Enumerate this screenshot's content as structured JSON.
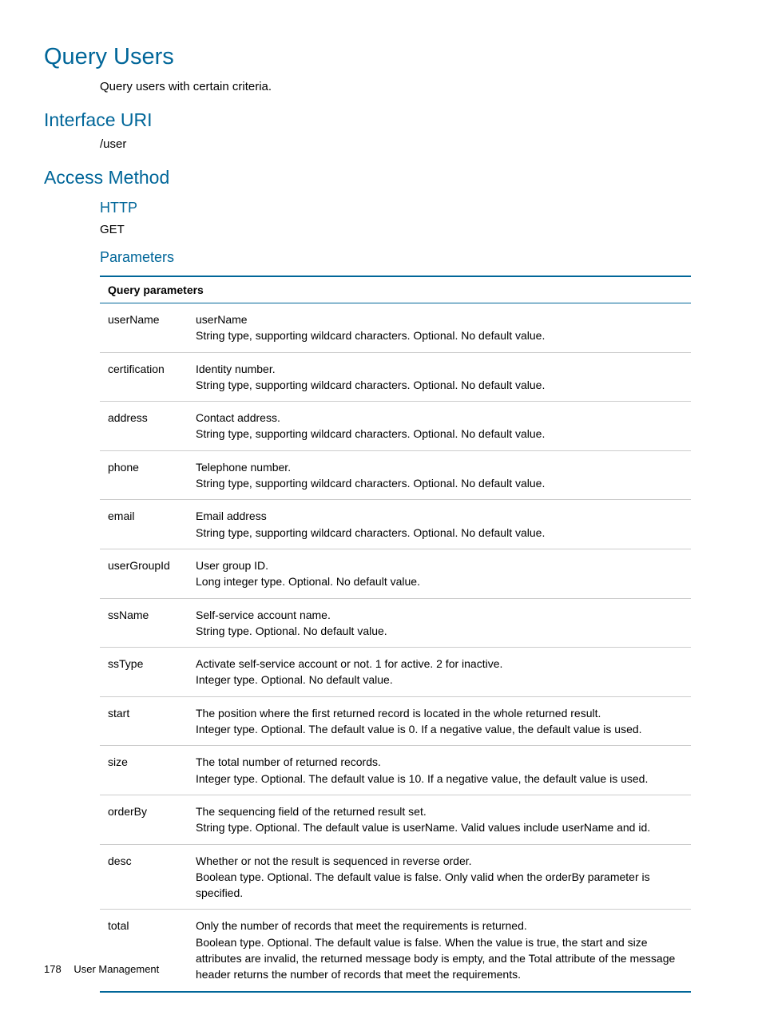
{
  "title": "Query Users",
  "description": "Query users with certain criteria.",
  "sections": {
    "interface_uri": {
      "heading": "Interface URI",
      "value": "/user"
    },
    "access_method": {
      "heading": "Access Method",
      "http_heading": "HTTP",
      "http_value": "GET",
      "parameters_heading": "Parameters"
    }
  },
  "table": {
    "header": "Query parameters",
    "rows": [
      {
        "name": "userName",
        "l1": "userName",
        "l2": "String type, supporting wildcard characters. Optional. No default value."
      },
      {
        "name": "certification",
        "l1": "Identity number.",
        "l2": "String type, supporting wildcard characters. Optional. No default value."
      },
      {
        "name": "address",
        "l1": "Contact address.",
        "l2": "String type, supporting wildcard characters. Optional. No default value."
      },
      {
        "name": "phone",
        "l1": "Telephone number.",
        "l2": "String type, supporting wildcard characters. Optional. No default value."
      },
      {
        "name": "email",
        "l1": "Email address",
        "l2": "String type, supporting wildcard characters. Optional. No default value."
      },
      {
        "name": "userGroupId",
        "l1": "User group ID.",
        "l2": "Long integer type. Optional. No default value."
      },
      {
        "name": "ssName",
        "l1": "Self-service account name.",
        "l2": "String type. Optional. No default value."
      },
      {
        "name": "ssType",
        "l1": "Activate self-service account or not. 1 for active. 2 for inactive.",
        "l2": "Integer type. Optional. No default value."
      },
      {
        "name": "start",
        "l1": "The position where the first returned record is located in the whole returned result.",
        "l2": "Integer type. Optional. The default value is 0. If a negative value, the default value is used."
      },
      {
        "name": "size",
        "l1": "The total number of returned records.",
        "l2": "Integer type. Optional. The default value is 10. If a negative value, the default value is used."
      },
      {
        "name": "orderBy",
        "l1": "The sequencing field of the returned result set.",
        "l2": "String type. Optional. The default value is userName. Valid values include userName and id."
      },
      {
        "name": "desc",
        "l1": "Whether or not the result is sequenced in reverse order.",
        "l2": "Boolean type. Optional. The default value is false. Only valid when the orderBy parameter is specified."
      },
      {
        "name": "total",
        "l1": "Only the number of records that meet the requirements is returned.",
        "l2": "Boolean type. Optional. The default value is false. When the value is true, the start and size attributes are invalid, the returned message body is empty, and the Total attribute of the message header returns the number of records that meet the requirements."
      }
    ]
  },
  "footer": {
    "page": "178",
    "section": "User Management"
  }
}
